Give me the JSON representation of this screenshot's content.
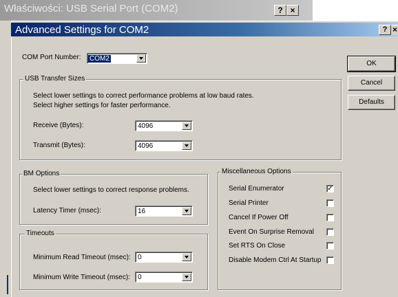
{
  "background_window": {
    "title": "Właściwości: USB Serial Port (COM2)",
    "help": "?",
    "close": "×"
  },
  "dialog": {
    "title": "Advanced Settings for COM2",
    "help": "?",
    "close": "×"
  },
  "com_port": {
    "label": "COM Port Number:",
    "value": "COM2"
  },
  "usb_transfer": {
    "legend": "USB Transfer Sizes",
    "desc_line1": "Select lower settings to correct performance problems at low baud rates.",
    "desc_line2": "Select higher settings for faster performance.",
    "receive_label": "Receive (Bytes):",
    "receive_value": "4096",
    "transmit_label": "Transmit (Bytes):",
    "transmit_value": "4096"
  },
  "bm_options": {
    "legend": "BM Options",
    "desc": "Select lower settings to correct response problems.",
    "latency_label": "Latency Timer (msec):",
    "latency_value": "16"
  },
  "timeouts": {
    "legend": "Timeouts",
    "min_read_label": "Minimum Read Timeout (msec):",
    "min_read_value": "0",
    "min_write_label": "Minimum Write Timeout (msec):",
    "min_write_value": "0"
  },
  "misc": {
    "legend": "Miscellaneous Options",
    "options": [
      {
        "label": "Serial Enumerator",
        "checked": true,
        "mark": "✓"
      },
      {
        "label": "Serial Printer",
        "checked": false,
        "mark": ""
      },
      {
        "label": "Cancel If Power Off",
        "checked": false,
        "mark": ""
      },
      {
        "label": "Event On Surprise Removal",
        "checked": false,
        "mark": ""
      },
      {
        "label": "Set RTS On Close",
        "checked": false,
        "mark": ""
      },
      {
        "label": "Disable Modem Ctrl At Startup",
        "checked": false,
        "mark": ""
      }
    ]
  },
  "buttons": {
    "ok": "OK",
    "cancel": "Cancel",
    "defaults": "Defaults"
  }
}
